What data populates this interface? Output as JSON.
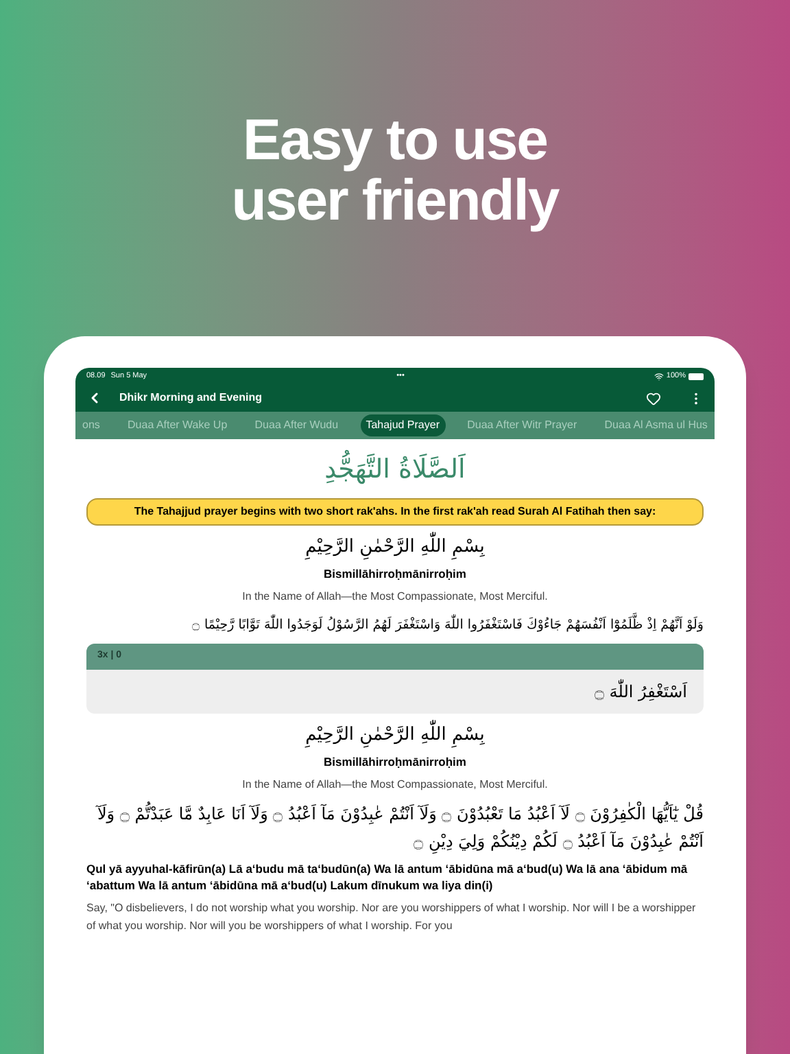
{
  "headline": [
    "Easy to use",
    "user friendly"
  ],
  "status_bar": {
    "time": "08.09",
    "date": "Sun 5 May",
    "dots": "•••",
    "battery": "100%"
  },
  "toolbar": {
    "title": "Dhikr Morning and Evening"
  },
  "tabs": [
    {
      "label": "ons",
      "selected": false
    },
    {
      "label": "Duaa After Wake Up",
      "selected": false
    },
    {
      "label": "Duaa After Wudu",
      "selected": false
    },
    {
      "label": "Tahajud Prayer",
      "selected": true
    },
    {
      "label": "Duaa After Witr Prayer",
      "selected": false
    },
    {
      "label": "Duaa Al Asma ul Hus",
      "selected": false
    }
  ],
  "content": {
    "arabic_title": "اَلصَّلَاةُ التَّهَجُّدِ",
    "notice": "The Tahajjud prayer begins with two short rak'ahs. In the first rak'ah read Surah Al Fatihah then say:",
    "blocks": [
      {
        "kind": "bismillah",
        "arabic": "بِسْمِ اللّٰهِ الرَّحْمٰنِ الرَّحِيْمِ",
        "latin": "Bismillāhirroḥmānirroḥim",
        "translation": "In the Name of Allah—the Most Compassionate, Most Merciful."
      },
      {
        "kind": "verse",
        "arabic": "وَلَوْ اَنَّهُمْ اِذْ ظَّلَمُوْٓا اَنْفُسَهُمْ جَاءُوْكَ فَاسْتَغْفَرُوا اللّٰهَ وَاسْتَغْفَرَ لَهُمُ الرَّسُوْلُ لَوَجَدُوا اللّٰهَ تَوَّابًا رَّحِيْمًا ۝"
      },
      {
        "kind": "counter",
        "count": "3x | 0",
        "arabic": "اَسْتَغْفِرُ اللّٰهَ ۝"
      },
      {
        "kind": "bismillah",
        "arabic": "بِسْمِ اللّٰهِ الرَّحْمٰنِ الرَّحِيْمِ",
        "latin": "Bismillāhirroḥmānirroḥim",
        "translation": "In the Name of Allah—the Most Compassionate, Most Merciful."
      },
      {
        "kind": "surah",
        "arabic": "قُلْ يٰٓاَيُّهَا الْكٰفِرُوْنَ ۝ لَآ اَعْبُدُ مَا تَعْبُدُوْنَ ۝ وَلَآ اَنْتُمْ عٰبِدُوْنَ مَآ اَعْبُدُ ۝ وَلَآ اَنَا عَابِدٌ مَّا عَبَدْتُّمْ ۝ وَلَآ اَنْتُمْ عٰبِدُوْنَ مَآ اَعْبُدُ ۝ لَكُمْ دِيْنُكُمْ وَلِيَ دِيْنِ ۝",
        "latin": "Qul yā ayyuhal-kāfirūn(a) Lā aʻbudu mā taʻbudūn(a) Wa lā antum ʻābidūna mā aʻbud(u) Wa lā ana ʻābidum mā ʻabattum Wa lā antum ʻābidūna mā aʻbud(u) Lakum dīnukum wa liya din(i)",
        "translation": "Say, \"O disbelievers, I do not worship what you worship. Nor are you worshippers of what I worship. Nor will I be a worshipper of what you worship. Nor will you be worshippers of what I worship. For you"
      }
    ]
  }
}
